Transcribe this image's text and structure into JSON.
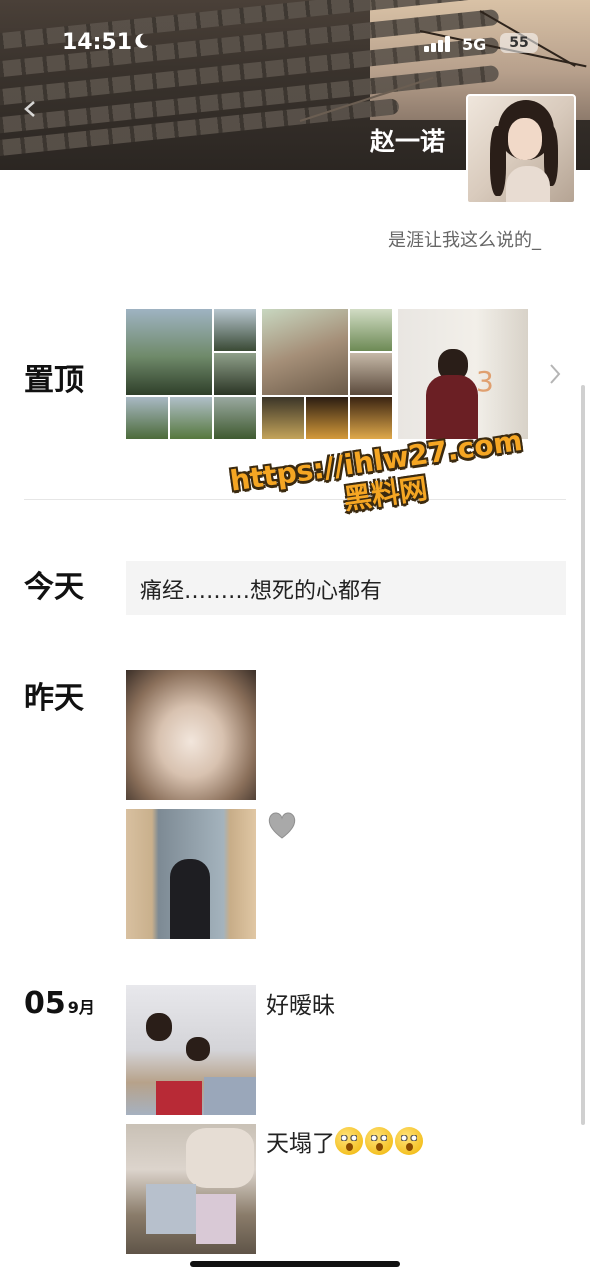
{
  "status_bar": {
    "time": "14:51",
    "network": "5G",
    "battery": "55"
  },
  "profile": {
    "username": "赵一诺",
    "signature": "是涯让我这么说的_"
  },
  "pinned": {
    "label": "置顶",
    "albums": [
      {
        "name": "pinned-album-outdoor"
      },
      {
        "name": "pinned-album-garden"
      },
      {
        "name": "pinned-album-room"
      }
    ]
  },
  "watermark": {
    "line1": "https://ihlw27.com",
    "line2": "黑料网"
  },
  "posts": [
    {
      "date": "今天",
      "text": "痛经………想死的心都有"
    },
    {
      "date": "昨天",
      "caption": "🩶"
    },
    {
      "day": "05",
      "month": "9月",
      "captions": [
        "好暧昧",
        "天塌了"
      ]
    }
  ],
  "colors": {
    "accent_watermark": "#f5a623",
    "text_post_bg": "#f4f4f4"
  },
  "icons": [
    "moon-icon",
    "signal-icon",
    "back-arrow-icon",
    "chevron-right-icon",
    "grey-heart-icon",
    "flushed-face-icon"
  ]
}
